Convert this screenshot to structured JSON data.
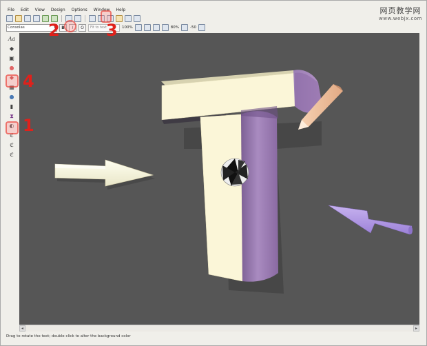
{
  "menu": [
    "File",
    "Edit",
    "View",
    "Design",
    "Options",
    "Window",
    "Help"
  ],
  "watermark": {
    "line1": "网页教学网",
    "line2": "www.webjx.com"
  },
  "toolbar2": {
    "font_name": "Consolas",
    "bold_label": "B",
    "italic_label": "I",
    "outline_label": "O",
    "fit_placeholder": "Fit to text",
    "zoom_value": "100%",
    "depth_value": "80%",
    "angle_value": "-50"
  },
  "annotations": {
    "one": "1",
    "two": "2",
    "three": "3",
    "four": "4"
  },
  "status": "Drag to rotate the text; double click to alter the background color",
  "colors": {
    "canvas_bg": "#565656",
    "annotation_red": "#e0211b"
  }
}
